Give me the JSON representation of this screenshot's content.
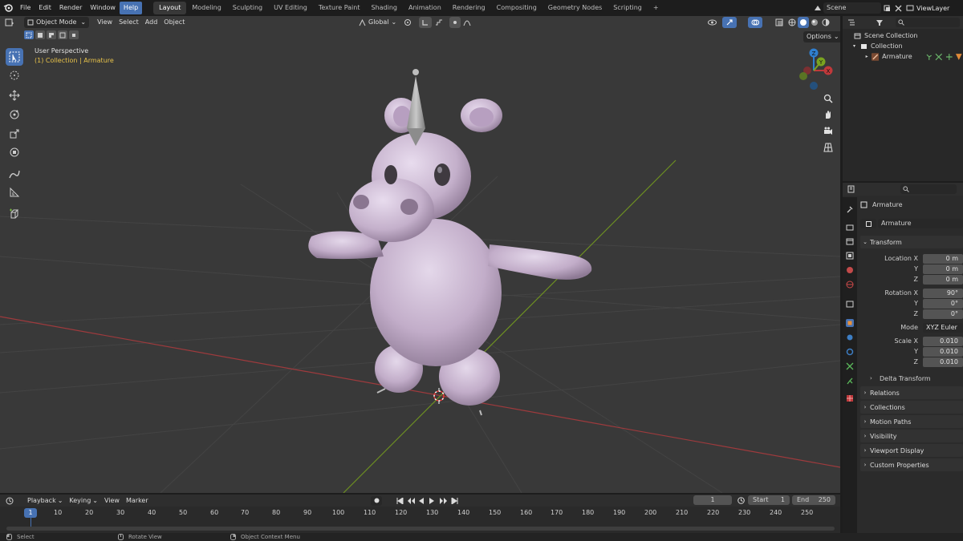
{
  "topbar": {
    "menus": [
      "File",
      "Edit",
      "Render",
      "Window",
      "Help"
    ],
    "workspaces": [
      "Layout",
      "Modeling",
      "Sculpting",
      "UV Editing",
      "Texture Paint",
      "Shading",
      "Animation",
      "Rendering",
      "Compositing",
      "Geometry Nodes",
      "Scripting"
    ],
    "active_workspace": "Layout",
    "add_workspace": "+",
    "scene": "Scene",
    "view_layer": "ViewLayer"
  },
  "viewport": {
    "mode": "Object Mode",
    "menus": [
      "View",
      "Select",
      "Add",
      "Object"
    ],
    "orientation": "Global",
    "options_label": "Options",
    "overlay_title": "User Perspective",
    "overlay_collection": "(1) Collection",
    "overlay_separator": " | ",
    "overlay_object": "Armature",
    "gizmo": {
      "x": "X",
      "y": "Y",
      "z": "Z"
    }
  },
  "outliner": {
    "scene_collection": "Scene Collection",
    "collection": "Collection",
    "armature": "Armature"
  },
  "properties": {
    "object_name": "Armature",
    "datablock": "Armature",
    "transform_header": "Transform",
    "location": {
      "label_x": "Location X",
      "label_y": "Y",
      "label_z": "Z",
      "x": "0 m",
      "y": "0 m",
      "z": "0 m"
    },
    "rotation": {
      "label_x": "Rotation X",
      "label_y": "Y",
      "label_z": "Z",
      "x": "90°",
      "y": "0°",
      "z": "0°"
    },
    "mode_label": "Mode",
    "mode_value": "XYZ Euler",
    "scale": {
      "label_x": "Scale X",
      "label_y": "Y",
      "label_z": "Z",
      "x": "0.010",
      "y": "0.010",
      "z": "0.010"
    },
    "delta_transform": "Delta Transform",
    "panels": [
      "Relations",
      "Collections",
      "Motion Paths",
      "Visibility",
      "Viewport Display",
      "Custom Properties"
    ]
  },
  "timeline": {
    "menus": [
      "Playback",
      "Keying",
      "View",
      "Marker"
    ],
    "current_frame": "1",
    "start_label": "Start",
    "start": "1",
    "end_label": "End",
    "end": "250",
    "ticks": [
      "10",
      "20",
      "30",
      "40",
      "50",
      "60",
      "70",
      "80",
      "90",
      "100",
      "110",
      "120",
      "130",
      "140",
      "150",
      "160",
      "170",
      "180",
      "190",
      "200",
      "210",
      "220",
      "230",
      "240",
      "250"
    ],
    "playhead": "1"
  },
  "statusbar": {
    "select": "Select",
    "rotate": "Rotate View",
    "context": "Object Context Menu"
  },
  "colors": {
    "accent": "#4772b3",
    "x_axis": "#c0393b",
    "y_axis": "#7aa320",
    "z_axis": "#2f7fd0",
    "model": "#c9b6cf"
  }
}
